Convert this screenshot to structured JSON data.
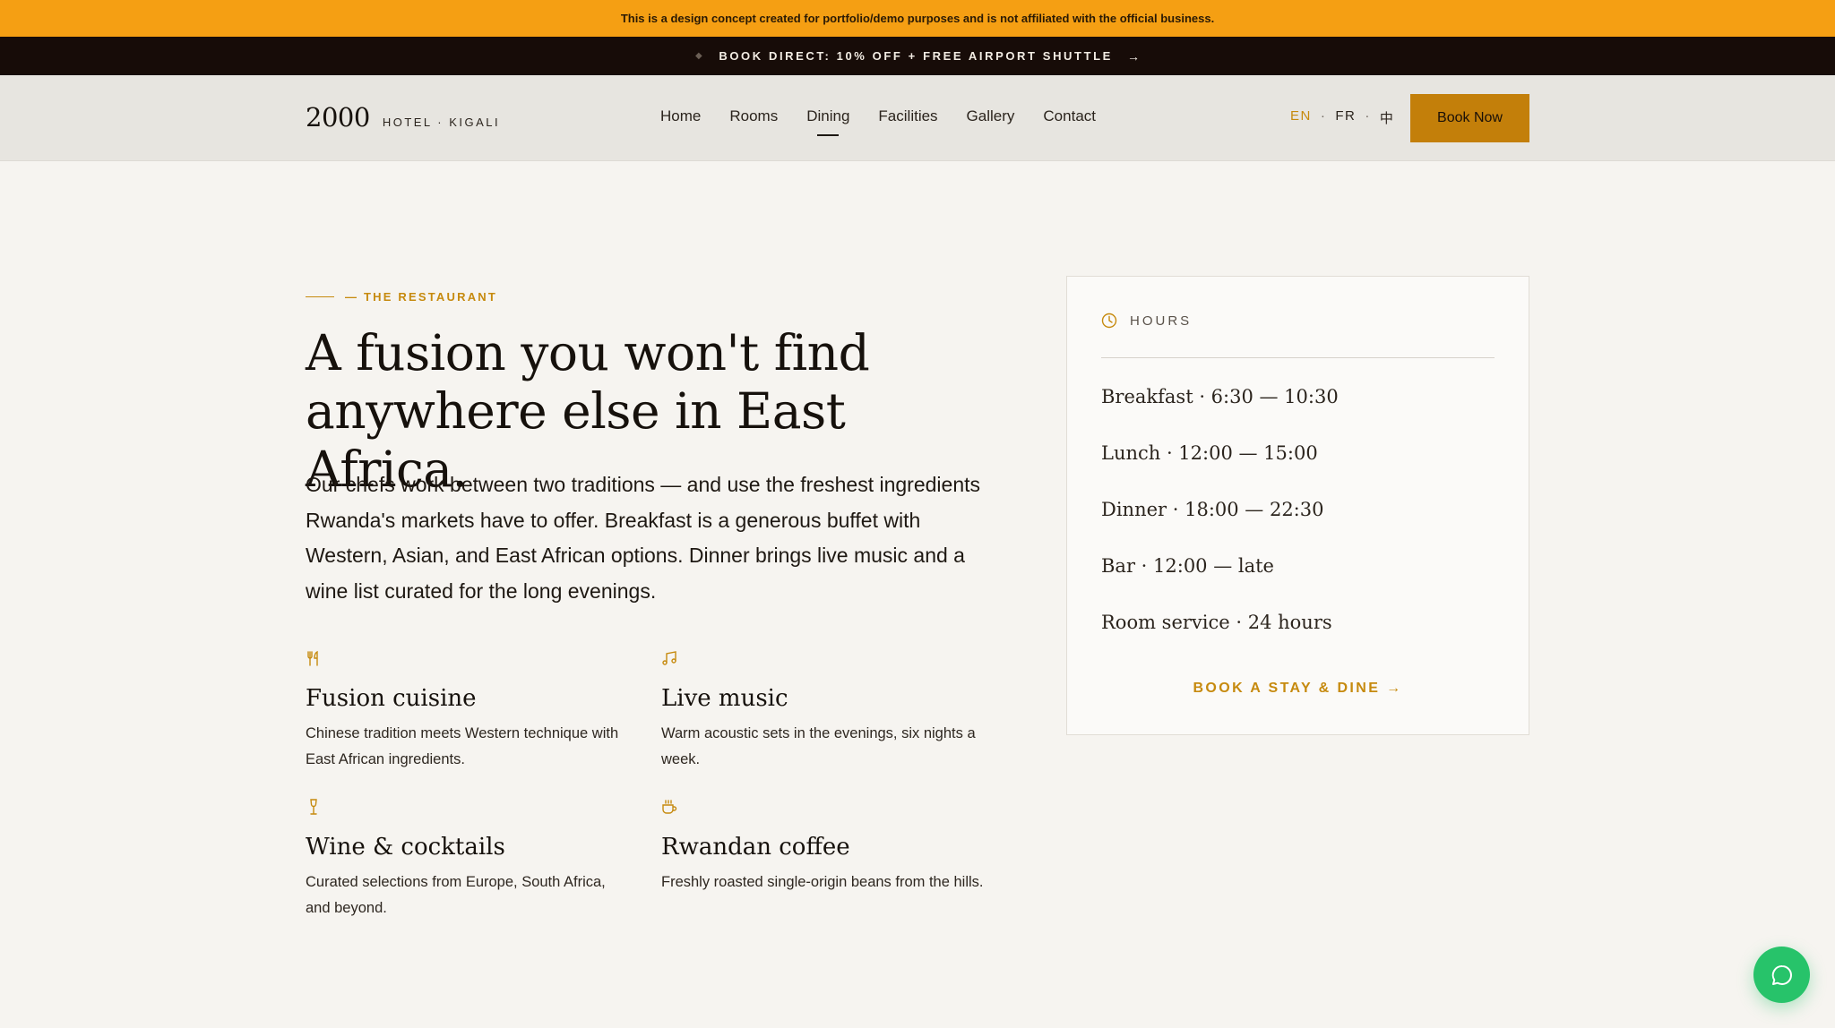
{
  "disclaimer": "This is a design concept created for portfolio/demo purposes and is not affiliated with the official business.",
  "promo": {
    "text": "BOOK DIRECT: 10% OFF + FREE AIRPORT SHUTTLE",
    "arrow": "→",
    "dot": "◆"
  },
  "header": {
    "logo_number": "2000",
    "logo_sub": "HOTEL · KIGALI",
    "menu": [
      "Home",
      "Rooms",
      "Dining",
      "Facilities",
      "Gallery",
      "Contact"
    ],
    "active_menu": "Dining",
    "languages": [
      "EN",
      "FR",
      "中"
    ],
    "active_language": "EN",
    "lang_sep": "·",
    "book_label": "Book Now"
  },
  "restaurant": {
    "eyebrow": "— THE RESTAURANT",
    "headline": "A fusion you won't find anywhere else in East Africa.",
    "intro": "Our chefs work between two traditions — and use the freshest ingredients Rwanda's markets have to offer. Breakfast is a generous buffet with Western, Asian, and East African options. Dinner brings live music and a wine list curated for the long evenings.",
    "features": [
      {
        "icon": "utensils-icon",
        "title": "Fusion cuisine",
        "desc": "Chinese tradition meets Western technique with East African ingredients."
      },
      {
        "icon": "music-note-icon",
        "title": "Live music",
        "desc": "Warm acoustic sets in the evenings, six nights a week."
      },
      {
        "icon": "wine-glass-icon",
        "title": "Wine & cocktails",
        "desc": "Curated selections from Europe, South Africa, and beyond."
      },
      {
        "icon": "coffee-cup-icon",
        "title": "Rwandan coffee",
        "desc": "Freshly roasted single-origin beans from the hills."
      }
    ]
  },
  "hours": {
    "title": "HOURS",
    "rows": [
      "Breakfast · 6:30 — 10:30",
      "Lunch · 12:00 — 15:00",
      "Dinner · 18:00 — 22:30",
      "Bar · 12:00 — late",
      "Room service · 24 hours"
    ],
    "cta": "BOOK A STAY & DINE →"
  },
  "colors": {
    "accent": "#c68a0e",
    "banner": "#f59f13",
    "promo_bg": "#170c08",
    "chat": "#27c36a"
  }
}
